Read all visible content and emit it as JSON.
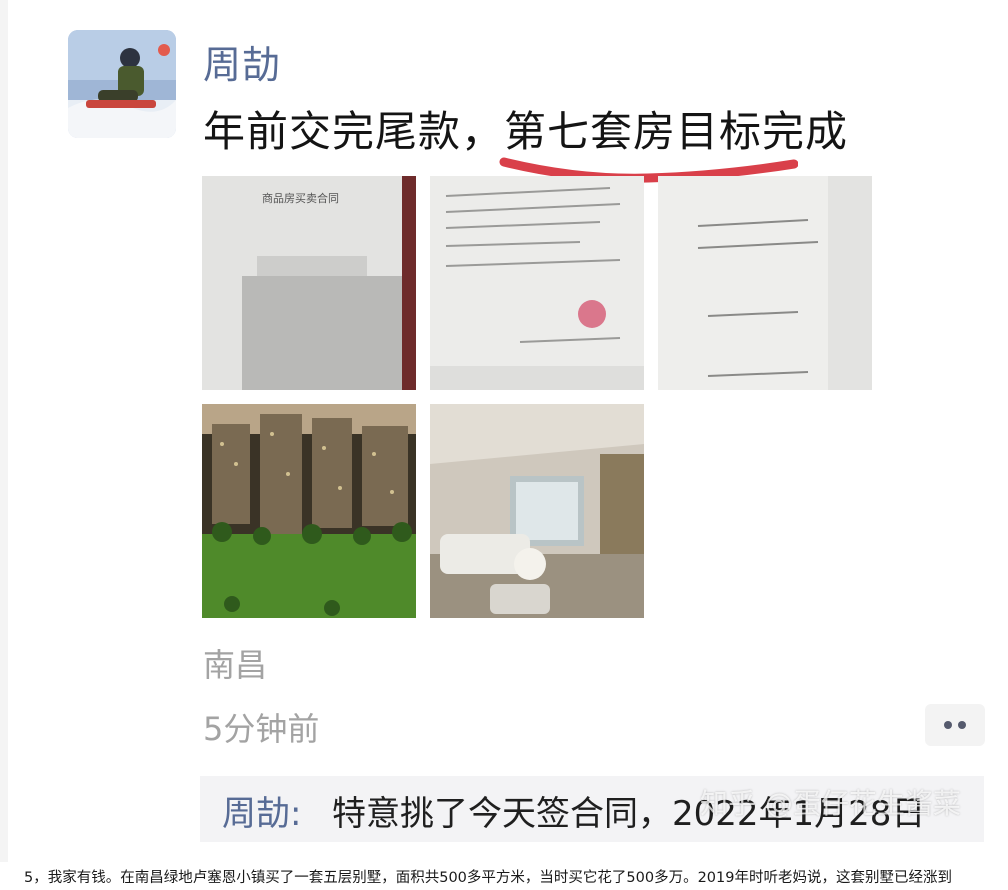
{
  "post": {
    "username": "周劼",
    "text_before": "年前交完尾款，",
    "text_highlight": "第七套房目标完成",
    "location": "南昌",
    "timestamp": "5分钟前",
    "photos": [
      {
        "name": "contract-cover-photo",
        "caption": "商品房买卖合同"
      },
      {
        "name": "signed-contract-photo"
      },
      {
        "name": "contract-page-photo"
      },
      {
        "name": "building-model-photo"
      },
      {
        "name": "living-room-photo"
      }
    ]
  },
  "comment": {
    "name": "周劼:",
    "text": "特意挑了今天签合同，2022年1月28日"
  },
  "watermark": "知乎 @蛋仔花生酱菜",
  "article": {
    "line": "5，我家有钱。在南昌绿地卢塞恩小镇买了一套五层别墅，面积共500多平方米，当时买它花了500多万。2019年时听老妈说，这套别墅已经涨到"
  },
  "colors": {
    "name_blue": "#576b95",
    "meta_gray": "#a3a3a3",
    "highlight_red": "#d9404a",
    "comment_bg": "#f3f3f5"
  },
  "icons": {
    "more": "more-dots-icon"
  }
}
